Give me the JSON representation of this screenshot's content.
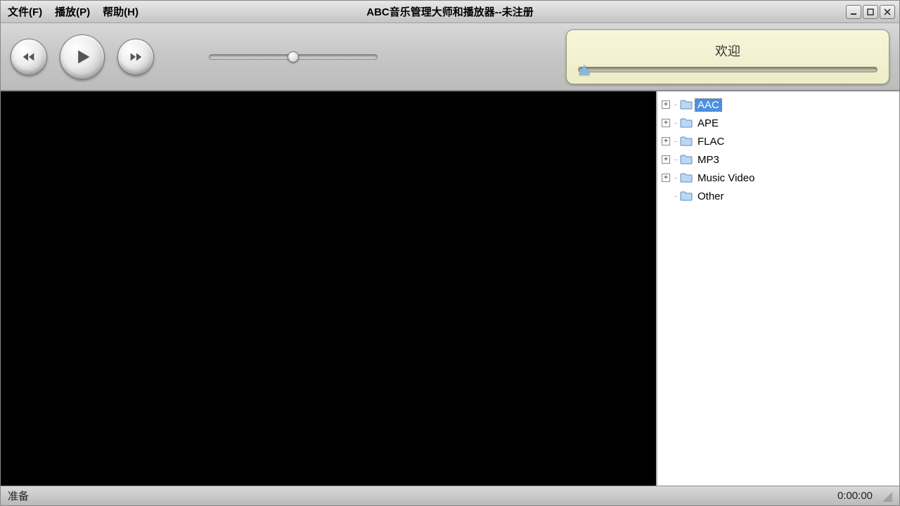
{
  "title": "ABC音乐管理大师和播放器--未注册",
  "menu": {
    "file": "文件(F)",
    "play": "播放(P)",
    "help": "帮助(H)"
  },
  "info": {
    "welcome": "欢迎"
  },
  "tree": {
    "items": [
      {
        "label": "AAC",
        "expandable": true,
        "selected": true
      },
      {
        "label": "APE",
        "expandable": true,
        "selected": false
      },
      {
        "label": "FLAC",
        "expandable": true,
        "selected": false
      },
      {
        "label": "MP3",
        "expandable": true,
        "selected": false
      },
      {
        "label": "Music Video",
        "expandable": true,
        "selected": false
      },
      {
        "label": "Other",
        "expandable": false,
        "selected": false
      }
    ]
  },
  "status": {
    "left": "准备",
    "time": "0:00:00"
  }
}
